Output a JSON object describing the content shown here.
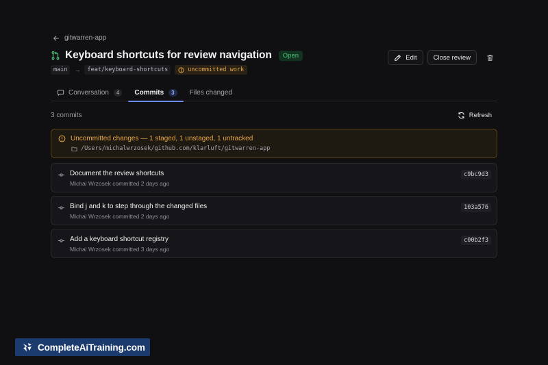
{
  "header": {
    "back_label": "gitwarren-app",
    "title": "Keyboard shortcuts for review navigation",
    "status": "Open",
    "base_branch": "main",
    "head_branch": "feat/keyboard-shortcuts",
    "work_status": "uncommitted work"
  },
  "actions": {
    "edit_label": "Edit",
    "close_label": "Close review"
  },
  "tabs": [
    {
      "label": "Conversation",
      "count": "4",
      "active": false
    },
    {
      "label": "Commits",
      "count": "3",
      "active": true
    },
    {
      "label": "Files changed",
      "count": "",
      "active": false
    }
  ],
  "commits_section": {
    "count_label": "3 commits",
    "refresh_label": "Refresh"
  },
  "alert": {
    "title": "Uncommitted changes — 1 staged, 1 unstaged, 1 untracked",
    "path": "/Users/michalwrzosek/github.com/klarluft/gitwarren-app"
  },
  "commits": [
    {
      "message": "Document the review shortcuts",
      "meta": "Michal Wrzosek committed 2 days ago",
      "sha": "c9bc9d3"
    },
    {
      "message": "Bind j and k to step through the changed files",
      "meta": "Michal Wrzosek committed 2 days ago",
      "sha": "103a576"
    },
    {
      "message": "Add a keyboard shortcut registry",
      "meta": "Michal Wrzosek committed 3 days ago",
      "sha": "c00b2f3"
    }
  ],
  "watermark": {
    "text": "CompleteAiTraining.com"
  },
  "colors": {
    "background": "#101012",
    "accent": "#6f8cf2",
    "open_green": "#4ec27a",
    "warning": "#e8a849",
    "brand_bg": "#1b3a6e"
  },
  "icons": {
    "back": "arrow-left-icon",
    "title": "git-pull-request-icon",
    "edit": "pencil-icon",
    "delete": "trash-icon",
    "conversation": "chat-bubble-icon",
    "refresh": "refresh-icon",
    "alert": "clock-warning-icon",
    "path": "folder-icon",
    "commit": "git-commit-icon"
  }
}
